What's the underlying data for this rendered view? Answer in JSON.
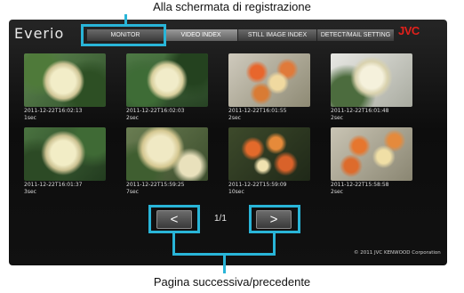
{
  "callouts": {
    "top": "Alla schermata di registrazione",
    "bottom": "Pagina successiva/precedente"
  },
  "header": {
    "brand": "Everio",
    "logo": "JVC",
    "tabs": [
      {
        "label": "MONITOR"
      },
      {
        "label": "VIDEO INDEX"
      },
      {
        "label": "STILL IMAGE INDEX"
      },
      {
        "label": "DETECT/MAIL SETTING"
      }
    ]
  },
  "thumbnails": [
    {
      "date": "2011-12-22T16:02:13",
      "duration": "1sec"
    },
    {
      "date": "2011-12-22T16:02:03",
      "duration": "2sec"
    },
    {
      "date": "2011-12-22T16:01:55",
      "duration": "2sec"
    },
    {
      "date": "2011-12-22T16:01:48",
      "duration": "2sec"
    },
    {
      "date": "2011-12-22T16:01:37",
      "duration": "3sec"
    },
    {
      "date": "2011-12-22T15:59:25",
      "duration": "7sec"
    },
    {
      "date": "2011-12-22T15:59:09",
      "duration": "10sec"
    },
    {
      "date": "2011-12-22T15:58:58",
      "duration": "2sec"
    }
  ],
  "pager": {
    "prev": "<",
    "next": ">",
    "page": "1/1"
  },
  "footer": {
    "copyright": "© 2011 JVC KENWOOD Corporation"
  },
  "colors": {
    "highlight": "#29b5d8",
    "logo": "#e3201b"
  }
}
